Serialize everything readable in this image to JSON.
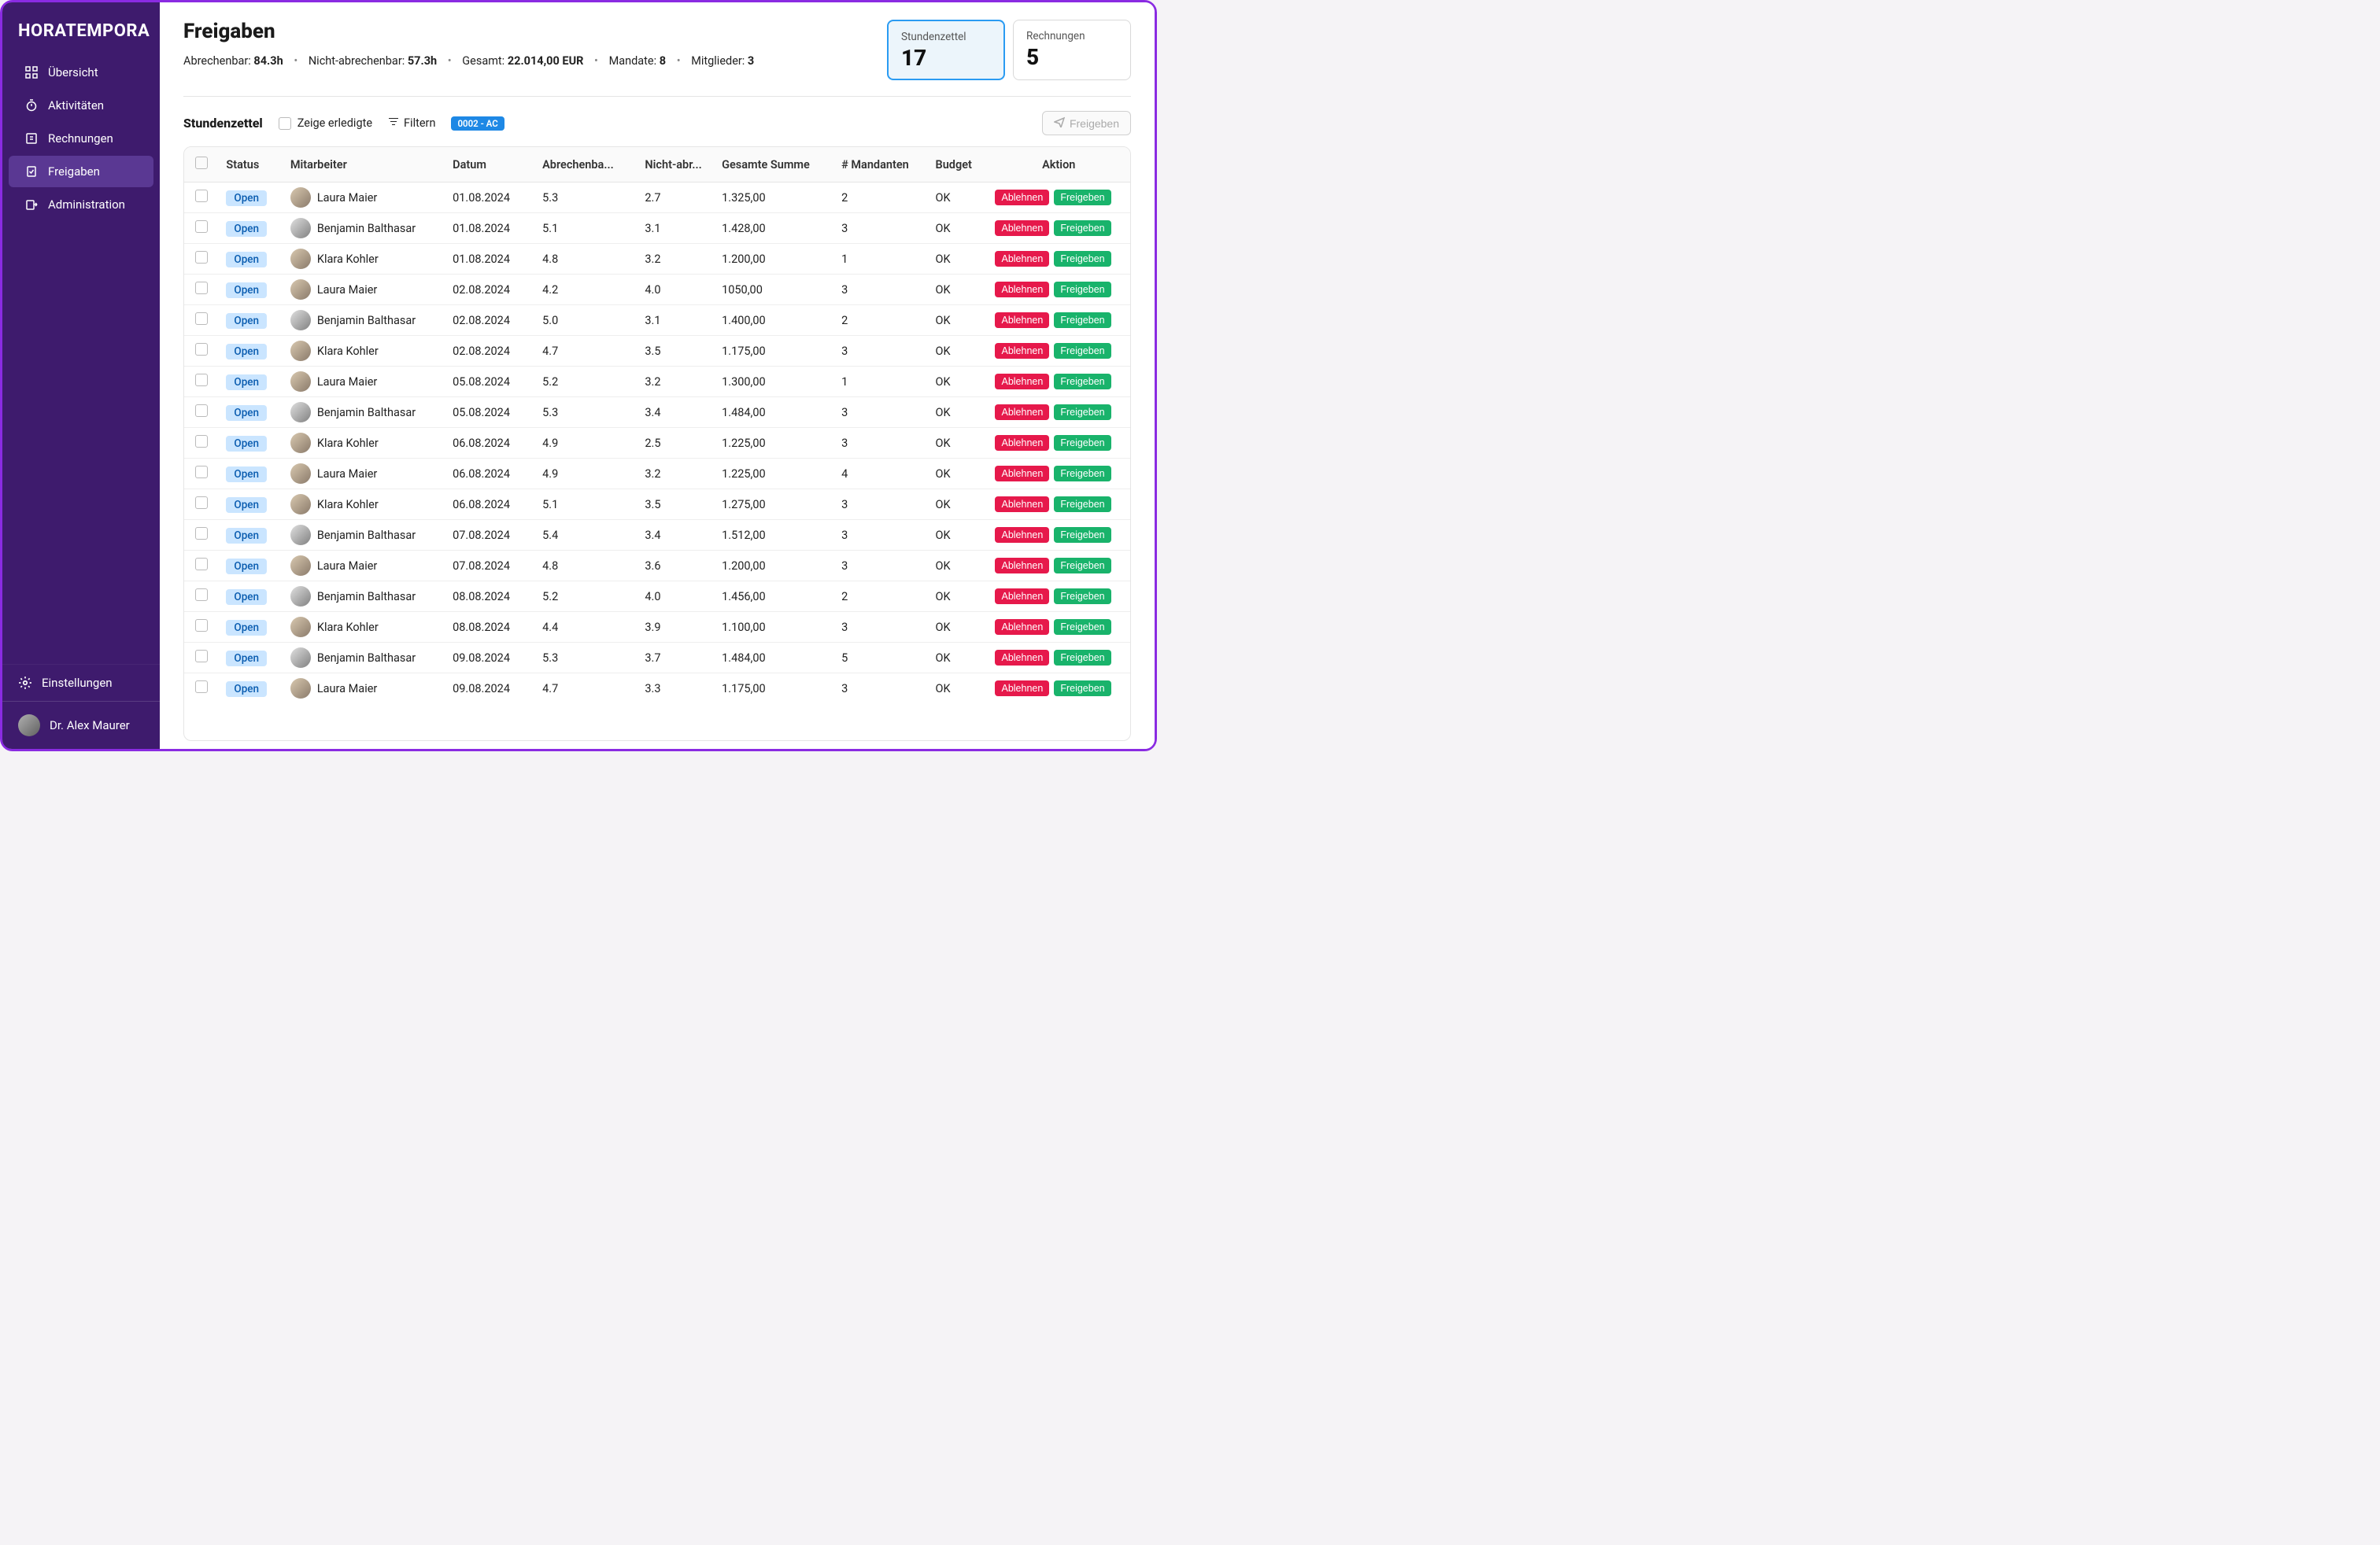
{
  "brand": "HORATEMPORA",
  "sidebar": {
    "items": [
      {
        "label": "Übersicht"
      },
      {
        "label": "Aktivitäten"
      },
      {
        "label": "Rechnungen"
      },
      {
        "label": "Freigaben"
      },
      {
        "label": "Administration"
      }
    ],
    "settings": "Einstellungen",
    "user": "Dr. Alex Maurer"
  },
  "page": {
    "title": "Freigaben",
    "summary": {
      "billable_label": "Abrechenbar:",
      "billable_value": "84.3h",
      "nonbillable_label": "Nicht-abrechenbar:",
      "nonbillable_value": "57.3h",
      "total_label": "Gesamt:",
      "total_value": "22.014,00 EUR",
      "mandates_label": "Mandate:",
      "mandates_value": "8",
      "members_label": "Mitglieder:",
      "members_value": "3"
    }
  },
  "cards": [
    {
      "label": "Stundenzettel",
      "count": "17"
    },
    {
      "label": "Rechnungen",
      "count": "5"
    }
  ],
  "toolbar": {
    "tab_title": "Stundenzettel",
    "show_done_label": "Zeige erledigte",
    "filter_label": "Filtern",
    "filter_chip": "0002 - AC",
    "release_label": "Freigeben"
  },
  "table": {
    "headers": [
      "",
      "Status",
      "Mitarbeiter",
      "Datum",
      "Abrechenba...",
      "Nicht-abr...",
      "Gesamte Summe",
      "# Mandanten",
      "Budget",
      "Aktion"
    ],
    "reject_label": "Ablehnen",
    "approve_label": "Freigeben",
    "rows": [
      {
        "status": "Open",
        "emp": "Laura Maier",
        "g": "f",
        "date": "01.08.2024",
        "bill": "5.3",
        "nonbill": "2.7",
        "sum": "1.325,00",
        "mand": "2",
        "budget": "OK"
      },
      {
        "status": "Open",
        "emp": "Benjamin Balthasar",
        "g": "m",
        "date": "01.08.2024",
        "bill": "5.1",
        "nonbill": "3.1",
        "sum": "1.428,00",
        "mand": "3",
        "budget": "OK"
      },
      {
        "status": "Open",
        "emp": "Klara Kohler",
        "g": "f",
        "date": "01.08.2024",
        "bill": "4.8",
        "nonbill": "3.2",
        "sum": "1.200,00",
        "mand": "1",
        "budget": "OK"
      },
      {
        "status": "Open",
        "emp": "Laura Maier",
        "g": "f",
        "date": "02.08.2024",
        "bill": "4.2",
        "nonbill": "4.0",
        "sum": "1050,00",
        "mand": "3",
        "budget": "OK"
      },
      {
        "status": "Open",
        "emp": "Benjamin Balthasar",
        "g": "m",
        "date": "02.08.2024",
        "bill": "5.0",
        "nonbill": "3.1",
        "sum": "1.400,00",
        "mand": "2",
        "budget": "OK"
      },
      {
        "status": "Open",
        "emp": "Klara Kohler",
        "g": "f",
        "date": "02.08.2024",
        "bill": "4.7",
        "nonbill": "3.5",
        "sum": "1.175,00",
        "mand": "3",
        "budget": "OK"
      },
      {
        "status": "Open",
        "emp": "Laura Maier",
        "g": "f",
        "date": "05.08.2024",
        "bill": "5.2",
        "nonbill": "3.2",
        "sum": "1.300,00",
        "mand": "1",
        "budget": "OK"
      },
      {
        "status": "Open",
        "emp": "Benjamin Balthasar",
        "g": "m",
        "date": "05.08.2024",
        "bill": "5.3",
        "nonbill": "3.4",
        "sum": "1.484,00",
        "mand": "3",
        "budget": "OK"
      },
      {
        "status": "Open",
        "emp": "Klara Kohler",
        "g": "f",
        "date": "06.08.2024",
        "bill": "4.9",
        "nonbill": "2.5",
        "sum": "1.225,00",
        "mand": "3",
        "budget": "OK"
      },
      {
        "status": "Open",
        "emp": "Laura Maier",
        "g": "f",
        "date": "06.08.2024",
        "bill": "4.9",
        "nonbill": "3.2",
        "sum": "1.225,00",
        "mand": "4",
        "budget": "OK"
      },
      {
        "status": "Open",
        "emp": "Klara Kohler",
        "g": "f",
        "date": "06.08.2024",
        "bill": "5.1",
        "nonbill": "3.5",
        "sum": "1.275,00",
        "mand": "3",
        "budget": "OK"
      },
      {
        "status": "Open",
        "emp": "Benjamin Balthasar",
        "g": "m",
        "date": "07.08.2024",
        "bill": "5.4",
        "nonbill": "3.4",
        "sum": "1.512,00",
        "mand": "3",
        "budget": "OK"
      },
      {
        "status": "Open",
        "emp": "Laura Maier",
        "g": "f",
        "date": "07.08.2024",
        "bill": "4.8",
        "nonbill": "3.6",
        "sum": "1.200,00",
        "mand": "3",
        "budget": "OK"
      },
      {
        "status": "Open",
        "emp": "Benjamin Balthasar",
        "g": "m",
        "date": "08.08.2024",
        "bill": "5.2",
        "nonbill": "4.0",
        "sum": "1.456,00",
        "mand": "2",
        "budget": "OK"
      },
      {
        "status": "Open",
        "emp": "Klara Kohler",
        "g": "f",
        "date": "08.08.2024",
        "bill": "4.4",
        "nonbill": "3.9",
        "sum": "1.100,00",
        "mand": "3",
        "budget": "OK"
      },
      {
        "status": "Open",
        "emp": "Benjamin Balthasar",
        "g": "m",
        "date": "09.08.2024",
        "bill": "5.3",
        "nonbill": "3.7",
        "sum": "1.484,00",
        "mand": "5",
        "budget": "OK"
      },
      {
        "status": "Open",
        "emp": "Laura Maier",
        "g": "f",
        "date": "09.08.2024",
        "bill": "4.7",
        "nonbill": "3.3",
        "sum": "1.175,00",
        "mand": "3",
        "budget": "OK"
      }
    ]
  }
}
